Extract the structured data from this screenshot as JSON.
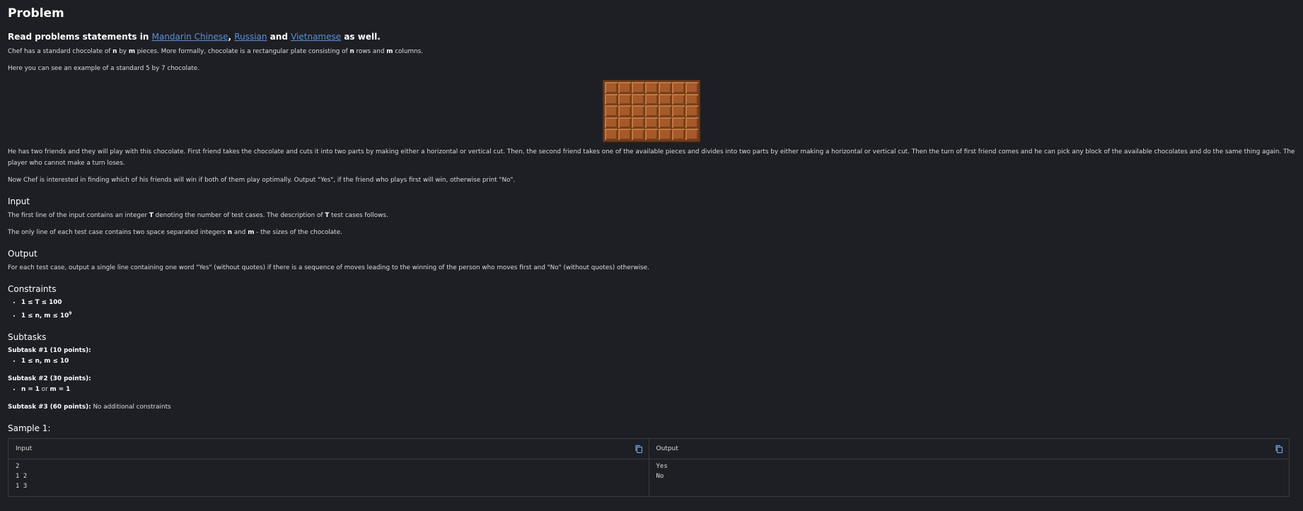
{
  "title": "Problem",
  "statement": {
    "prefix": "Read problems statements in",
    "lang1": "Mandarin Chinese",
    "sep": ",",
    "lang2": "Russian",
    "and": "and",
    "lang3": "Vietnamese",
    "suffix": "as well."
  },
  "para1": {
    "a": "Chef has a standard chocolate of ",
    "n": "n",
    "b": " by ",
    "m": "m",
    "c": " pieces. More formally, chocolate is a rectangular plate consisting of ",
    "n2": "n",
    "d": " rows and ",
    "m2": "m",
    "e": " columns."
  },
  "para2": "Here you can see an example of a standard 5 by 7 chocolate.",
  "chocolate": {
    "rows": 5,
    "cols": 7,
    "color": "#a65a2a"
  },
  "para3": "He has two friends and they will play with this chocolate. First friend takes the chocolate and cuts it into two parts by making either a horizontal or vertical cut. Then, the second friend takes one of the available pieces and divides into two parts by either making a horizontal or vertical cut. Then the turn of first friend comes and he can pick any block of the available chocolates and do the same thing again. The player who cannot make a turn loses.",
  "para4": "Now Chef is interested in finding which of his friends will win if both of them play optimally. Output \"Yes\", if the friend who plays first will win, otherwise print \"No\".",
  "input": {
    "heading": "Input",
    "p1a": "The first line of the input contains an integer ",
    "p1T": "T",
    "p1b": " denoting the number of test cases. The description of ",
    "p1T2": "T",
    "p1c": " test cases follows.",
    "p2a": "The only line of each test case contains two space separated integers ",
    "p2n": "n",
    "p2b": " and ",
    "p2m": "m",
    "p2c": " - the sizes of the chocolate."
  },
  "output": {
    "heading": "Output",
    "text": "For each test case, output a single line containing one word \"Yes\" (without quotes) if there is a sequence of moves leading to the winning of the person who moves first and \"No\" (without quotes) otherwise."
  },
  "constraints": {
    "heading": "Constraints",
    "c1": "1 ≤ T ≤ 100",
    "c2": "1 ≤ n, m ≤ 10",
    "c2sup": "9"
  },
  "subtasks": {
    "heading": "Subtasks",
    "s1title": "Subtask #1 (10 points):",
    "s1item": "1 ≤ n, m ≤ 10",
    "s2title": "Subtask #2 (30 points):",
    "s2n": "n = 1",
    "s2or": " or ",
    "s2m": "m = 1",
    "s3title": "Subtask #3 (60 points):",
    "s3text": " No additional constraints"
  },
  "sample": {
    "heading": "Sample 1:",
    "input_label": "Input",
    "output_label": "Output",
    "input_text": "2\n1 2\n1 3",
    "output_text": "Yes\nNo"
  }
}
